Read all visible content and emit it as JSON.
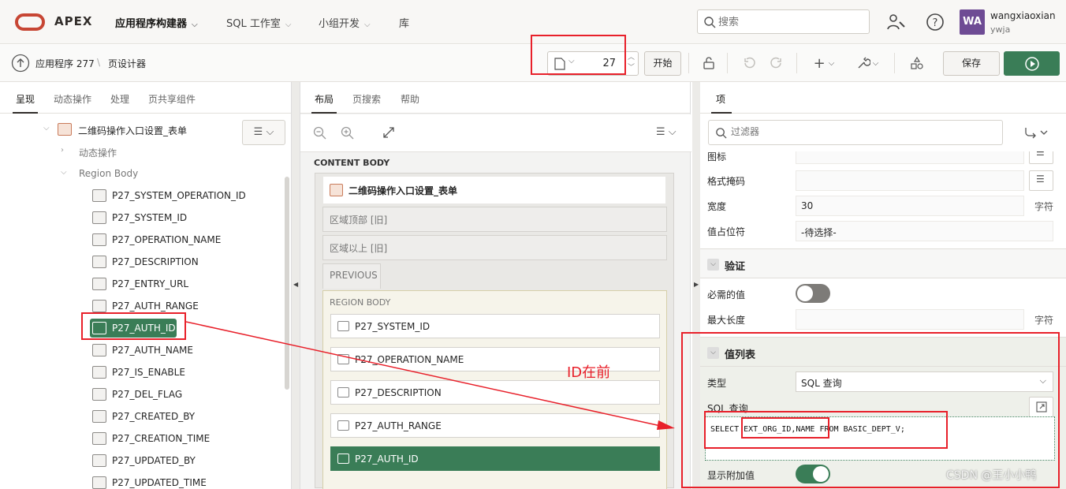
{
  "app": {
    "brand": "APEX"
  },
  "nav": {
    "items": [
      {
        "label": "应用程序构建器",
        "chevron": true,
        "active": true
      },
      {
        "label": "SQL 工作室",
        "chevron": true
      },
      {
        "label": "小组开发",
        "chevron": true
      },
      {
        "label": "库",
        "chevron": false
      }
    ],
    "search_placeholder": "搜索",
    "user_initials": "WA",
    "user_name": "wangxiaoxian",
    "user_workspace": "ywja"
  },
  "toolbar": {
    "breadcrumb_app": "应用程序 277",
    "breadcrumb_sep": "\\",
    "breadcrumb_page": "页设计器",
    "page_number": "27",
    "go_label": "开始",
    "save_label": "保存"
  },
  "left": {
    "tabs": [
      "呈现",
      "动态操作",
      "处理",
      "页共享组件"
    ],
    "region_title": "二维码操作入口设置_表单",
    "dynamic_actions": "动态操作",
    "region_body": "Region Body",
    "items": [
      "P27_SYSTEM_OPERATION_ID",
      "P27_SYSTEM_ID",
      "P27_OPERATION_NAME",
      "P27_DESCRIPTION",
      "P27_ENTRY_URL",
      "P27_AUTH_RANGE",
      "P27_AUTH_ID",
      "P27_AUTH_NAME",
      "P27_IS_ENABLE",
      "P27_DEL_FLAG",
      "P27_CREATED_BY",
      "P27_CREATION_TIME",
      "P27_UPDATED_BY",
      "P27_UPDATED_TIME"
    ]
  },
  "middle": {
    "tabs": [
      "布局",
      "页搜索",
      "帮助"
    ],
    "content_body": "CONTENT BODY",
    "region_title": "二维码操作入口设置_表单",
    "slot_region_header": "区域顶部 [旧]",
    "slot_above_region": "区域以上 [旧]",
    "slot_previous": "PREVIOUS",
    "region_body_label": "REGION BODY",
    "items": [
      "P27_SYSTEM_ID",
      "P27_OPERATION_NAME",
      "P27_DESCRIPTION",
      "P27_AUTH_RANGE",
      "P27_AUTH_ID"
    ]
  },
  "right": {
    "tab": "项",
    "filter_placeholder": "过滤器",
    "icon_label": "图标",
    "format_mask_label": "格式掩码",
    "width_label": "宽度",
    "width_value": "30",
    "width_unit": "字符",
    "placeholder_label": "值占位符",
    "placeholder_value": "-待选择-",
    "validation_section": "验证",
    "required_label": "必需的值",
    "maxlen_label": "最大长度",
    "maxlen_unit": "字符",
    "lov_section": "值列表",
    "type_label": "类型",
    "type_value": "SQL 查询",
    "sql_label": "SQL 查询",
    "sql_value": "SELECT EXT_ORG_ID,NAME FROM BASIC_DEPT_V;",
    "extra_label": "显示附加值"
  },
  "annotation": "ID在前",
  "watermark": "CSDN @王小小鸭",
  "colors": {
    "accent_green": "#3a7d57",
    "annotation_red": "#e8202a",
    "oracle_red": "#c74634"
  }
}
